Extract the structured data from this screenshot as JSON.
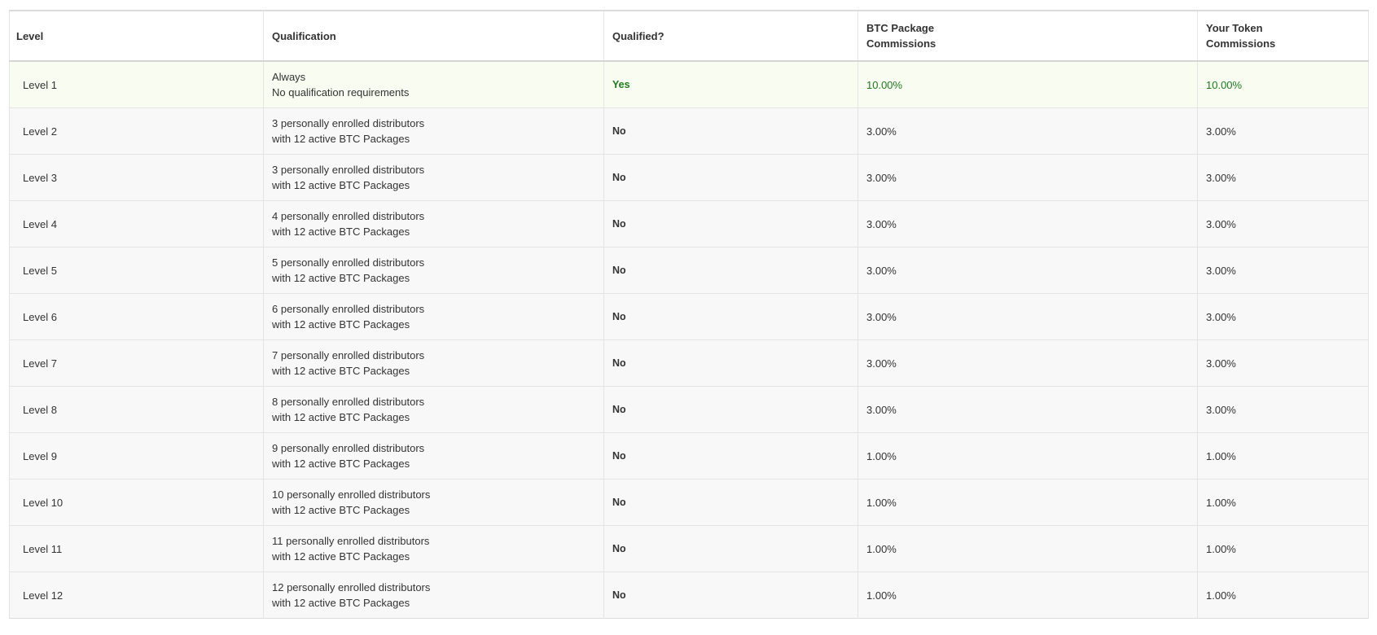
{
  "table": {
    "headers": {
      "level": "Level",
      "qualification": "Qualification",
      "qualified": "Qualified?",
      "btc_line1": "BTC Package",
      "btc_line2": "Commissions",
      "token_line1": "Your Token",
      "token_line2": "Commissions"
    },
    "rows": [
      {
        "level": "Level 1",
        "qual_line1": "Always",
        "qual_line2": "No qualification requirements",
        "qualified": "Yes",
        "btc": "10.00%",
        "token": "10.00%"
      },
      {
        "level": "Level 2",
        "qual_line1": "3 personally enrolled distributors",
        "qual_line2": "with 12 active BTC Packages",
        "qualified": "No",
        "btc": "3.00%",
        "token": "3.00%"
      },
      {
        "level": "Level 3",
        "qual_line1": "3 personally enrolled distributors",
        "qual_line2": "with 12 active BTC Packages",
        "qualified": "No",
        "btc": "3.00%",
        "token": "3.00%"
      },
      {
        "level": "Level 4",
        "qual_line1": "4 personally enrolled distributors",
        "qual_line2": "with 12 active BTC Packages",
        "qualified": "No",
        "btc": "3.00%",
        "token": "3.00%"
      },
      {
        "level": "Level 5",
        "qual_line1": "5 personally enrolled distributors",
        "qual_line2": "with 12 active BTC Packages",
        "qualified": "No",
        "btc": "3.00%",
        "token": "3.00%"
      },
      {
        "level": "Level 6",
        "qual_line1": "6 personally enrolled distributors",
        "qual_line2": "with 12 active BTC Packages",
        "qualified": "No",
        "btc": "3.00%",
        "token": "3.00%"
      },
      {
        "level": "Level 7",
        "qual_line1": "7 personally enrolled distributors",
        "qual_line2": "with 12 active BTC Packages",
        "qualified": "No",
        "btc": "3.00%",
        "token": "3.00%"
      },
      {
        "level": "Level 8",
        "qual_line1": "8 personally enrolled distributors",
        "qual_line2": "with 12 active BTC Packages",
        "qualified": "No",
        "btc": "3.00%",
        "token": "3.00%"
      },
      {
        "level": "Level 9",
        "qual_line1": "9 personally enrolled distributors",
        "qual_line2": "with 12 active BTC Packages",
        "qualified": "No",
        "btc": "1.00%",
        "token": "1.00%"
      },
      {
        "level": "Level 10",
        "qual_line1": "10 personally enrolled distributors",
        "qual_line2": "with 12 active BTC Packages",
        "qualified": "No",
        "btc": "1.00%",
        "token": "1.00%"
      },
      {
        "level": "Level 11",
        "qual_line1": "11 personally enrolled distributors",
        "qual_line2": "with 12 active BTC Packages",
        "qualified": "No",
        "btc": "1.00%",
        "token": "1.00%"
      },
      {
        "level": "Level 12",
        "qual_line1": "12 personally enrolled distributors",
        "qual_line2": "with 12 active BTC Packages",
        "qualified": "No",
        "btc": "1.00%",
        "token": "1.00%"
      }
    ]
  },
  "colors": {
    "qualified_text": "#1f7a1f",
    "qualified_row_bg": "#f8fcf1",
    "row_bg": "#f8f8f8",
    "border": "#e4e4e4"
  }
}
